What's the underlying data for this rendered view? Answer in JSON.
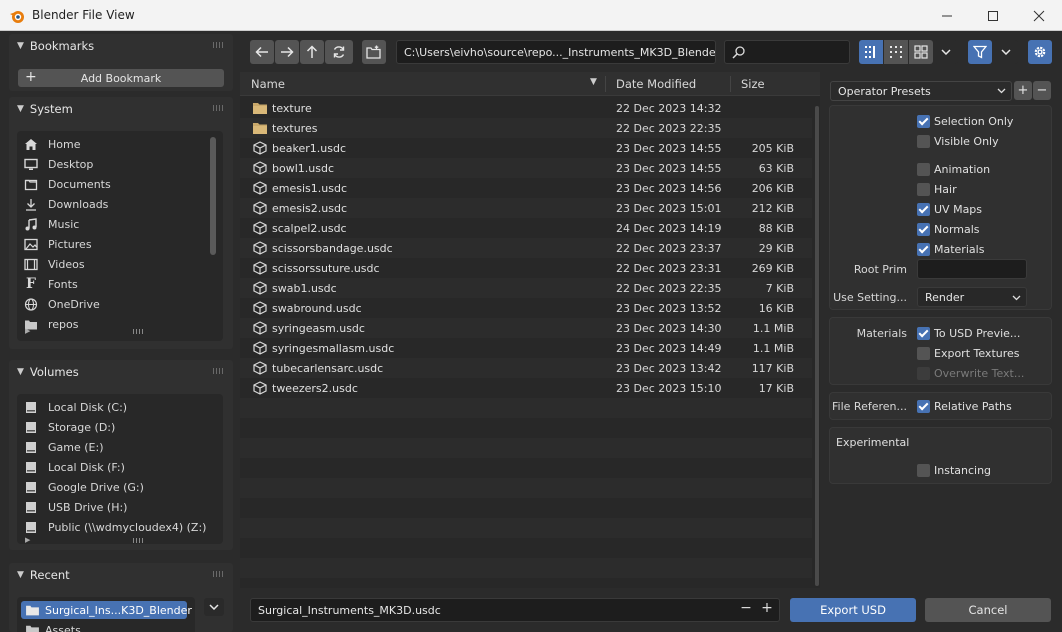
{
  "window": {
    "title": "Blender File View"
  },
  "bookmarks": {
    "title": "Bookmarks",
    "add_label": "Add Bookmark"
  },
  "system": {
    "title": "System",
    "items": [
      {
        "label": "Home",
        "icon": "home-icon"
      },
      {
        "label": "Desktop",
        "icon": "desktop-icon"
      },
      {
        "label": "Documents",
        "icon": "documents-icon"
      },
      {
        "label": "Downloads",
        "icon": "download-icon"
      },
      {
        "label": "Music",
        "icon": "music-icon"
      },
      {
        "label": "Pictures",
        "icon": "picture-icon"
      },
      {
        "label": "Videos",
        "icon": "video-icon"
      },
      {
        "label": "Fonts",
        "icon": "font-icon"
      },
      {
        "label": "OneDrive",
        "icon": "globe-icon"
      },
      {
        "label": "repos",
        "icon": "folder-icon"
      }
    ]
  },
  "volumes": {
    "title": "Volumes",
    "items": [
      {
        "label": "Local Disk (C:)"
      },
      {
        "label": "Storage (D:)"
      },
      {
        "label": "Game (E:)"
      },
      {
        "label": "Local Disk (F:)"
      },
      {
        "label": "Google Drive (G:)"
      },
      {
        "label": "USB Drive (H:)"
      },
      {
        "label": "Public (\\\\wdmycloudex4) (Z:)"
      }
    ]
  },
  "recent": {
    "title": "Recent",
    "items": [
      {
        "label": "Surgical_Ins...K3D_Blender",
        "selected": true
      },
      {
        "label": "Assets",
        "selected": false
      }
    ]
  },
  "toolbar": {
    "path": "C:\\Users\\eivho\\source\\repo..._Instruments_MK3D_Blender\\",
    "search_placeholder": ""
  },
  "columns": {
    "name": "Name",
    "date": "Date Modified",
    "size": "Size"
  },
  "files": [
    {
      "name": "texture",
      "date": "22 Dec 2023 14:32",
      "size": "",
      "type": "folder"
    },
    {
      "name": "textures",
      "date": "22 Dec 2023 22:35",
      "size": "",
      "type": "folder"
    },
    {
      "name": "beaker1.usdc",
      "date": "23 Dec 2023 14:55",
      "size": "205 KiB",
      "type": "file"
    },
    {
      "name": "bowl1.usdc",
      "date": "23 Dec 2023 14:55",
      "size": "63 KiB",
      "type": "file"
    },
    {
      "name": "emesis1.usdc",
      "date": "23 Dec 2023 14:56",
      "size": "206 KiB",
      "type": "file"
    },
    {
      "name": "emesis2.usdc",
      "date": "23 Dec 2023 15:01",
      "size": "212 KiB",
      "type": "file"
    },
    {
      "name": "scalpel2.usdc",
      "date": "24 Dec 2023 14:19",
      "size": "88 KiB",
      "type": "file"
    },
    {
      "name": "scissorsbandage.usdc",
      "date": "22 Dec 2023 23:37",
      "size": "29 KiB",
      "type": "file"
    },
    {
      "name": "scissorssuture.usdc",
      "date": "22 Dec 2023 23:31",
      "size": "269 KiB",
      "type": "file"
    },
    {
      "name": "swab1.usdc",
      "date": "22 Dec 2023 22:35",
      "size": "7 KiB",
      "type": "file"
    },
    {
      "name": "swabround.usdc",
      "date": "23 Dec 2023 13:52",
      "size": "16 KiB",
      "type": "file"
    },
    {
      "name": "syringeasm.usdc",
      "date": "23 Dec 2023 14:30",
      "size": "1.1 MiB",
      "type": "file"
    },
    {
      "name": "syringesmallasm.usdc",
      "date": "23 Dec 2023 14:49",
      "size": "1.1 MiB",
      "type": "file"
    },
    {
      "name": "tubecarlensarc.usdc",
      "date": "23 Dec 2023 13:42",
      "size": "117 KiB",
      "type": "file"
    },
    {
      "name": "tweezers2.usdc",
      "date": "23 Dec 2023 15:10",
      "size": "17 KiB",
      "type": "file"
    }
  ],
  "footer": {
    "filename": "Surgical_Instruments_MK3D.usdc",
    "export_label": "Export USD",
    "cancel_label": "Cancel"
  },
  "options": {
    "presets_label": "Operator Presets",
    "selection_only": "Selection Only",
    "visible_only": "Visible Only",
    "animation": "Animation",
    "hair": "Hair",
    "uv_maps": "UV Maps",
    "normals": "Normals",
    "materials": "Materials",
    "root_prim_label": "Root Prim",
    "root_prim_value": "",
    "use_settings_label": "Use Setting...",
    "use_settings_value": "Render",
    "materials_group_label": "Materials",
    "to_usd_preview": "To USD Previe...",
    "export_textures": "Export Textures",
    "overwrite_textures": "Overwrite Text...",
    "file_references_label": "File Referen...",
    "relative_paths": "Relative Paths",
    "experimental_label": "Experimental",
    "instancing": "Instancing"
  },
  "colors": {
    "accent": "#4772b3",
    "panel": "#303030",
    "list": "#282828"
  }
}
